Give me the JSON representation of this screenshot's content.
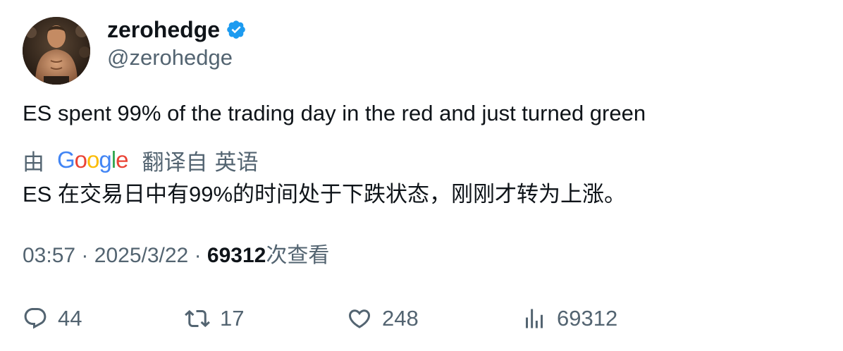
{
  "tweet": {
    "display_name": "zerohedge",
    "handle": "@zerohedge",
    "text": "ES spent 99% of the trading day in the red and just turned green",
    "translation": {
      "prefix": "由",
      "provider": "Google",
      "provider_letters": [
        "G",
        "o",
        "o",
        "g",
        "l",
        "e"
      ],
      "provider_colors": [
        "#4285f4",
        "#ea4335",
        "#fbbc05",
        "#4285f4",
        "#34a853",
        "#ea4335"
      ],
      "suffix": "翻译自",
      "language": "英语",
      "text": "ES 在交易日中有99%的时间处于下跌状态，刚刚才转为上涨。"
    },
    "meta": {
      "time": "03:57",
      "separator": "·",
      "date": "2025/3/22",
      "views_count": "69312",
      "views_label": "次查看"
    },
    "actions": {
      "replies": "44",
      "retweets": "17",
      "likes": "248",
      "views": "69312"
    }
  },
  "icons": {
    "verified": "verified-badge-icon",
    "reply": "reply-icon",
    "retweet": "retweet-icon",
    "like": "heart-icon",
    "views": "bar-chart-icon"
  },
  "colors": {
    "text_primary": "#0f1419",
    "text_secondary": "#536471",
    "verified_blue": "#1d9bf0"
  }
}
